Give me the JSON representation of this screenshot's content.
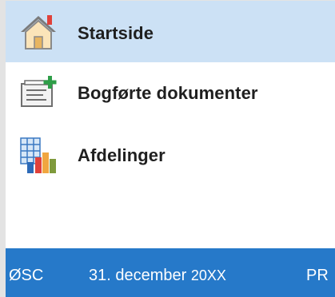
{
  "nav": {
    "items": [
      {
        "label": "Startside",
        "icon": "house-icon",
        "selected": true
      },
      {
        "label": "Bogførte dokumenter",
        "icon": "posted-documents-icon",
        "selected": false
      },
      {
        "label": "Afdelinger",
        "icon": "departments-icon",
        "selected": false
      }
    ]
  },
  "statusbar": {
    "company": "ØSC",
    "date_day_month": "31. december",
    "date_year": "20XX",
    "mode": "PR"
  },
  "colors": {
    "selected_bg": "#cce1f5",
    "statusbar_bg": "#2679c9",
    "accent_red": "#e0413a",
    "accent_green": "#2e9e48"
  }
}
